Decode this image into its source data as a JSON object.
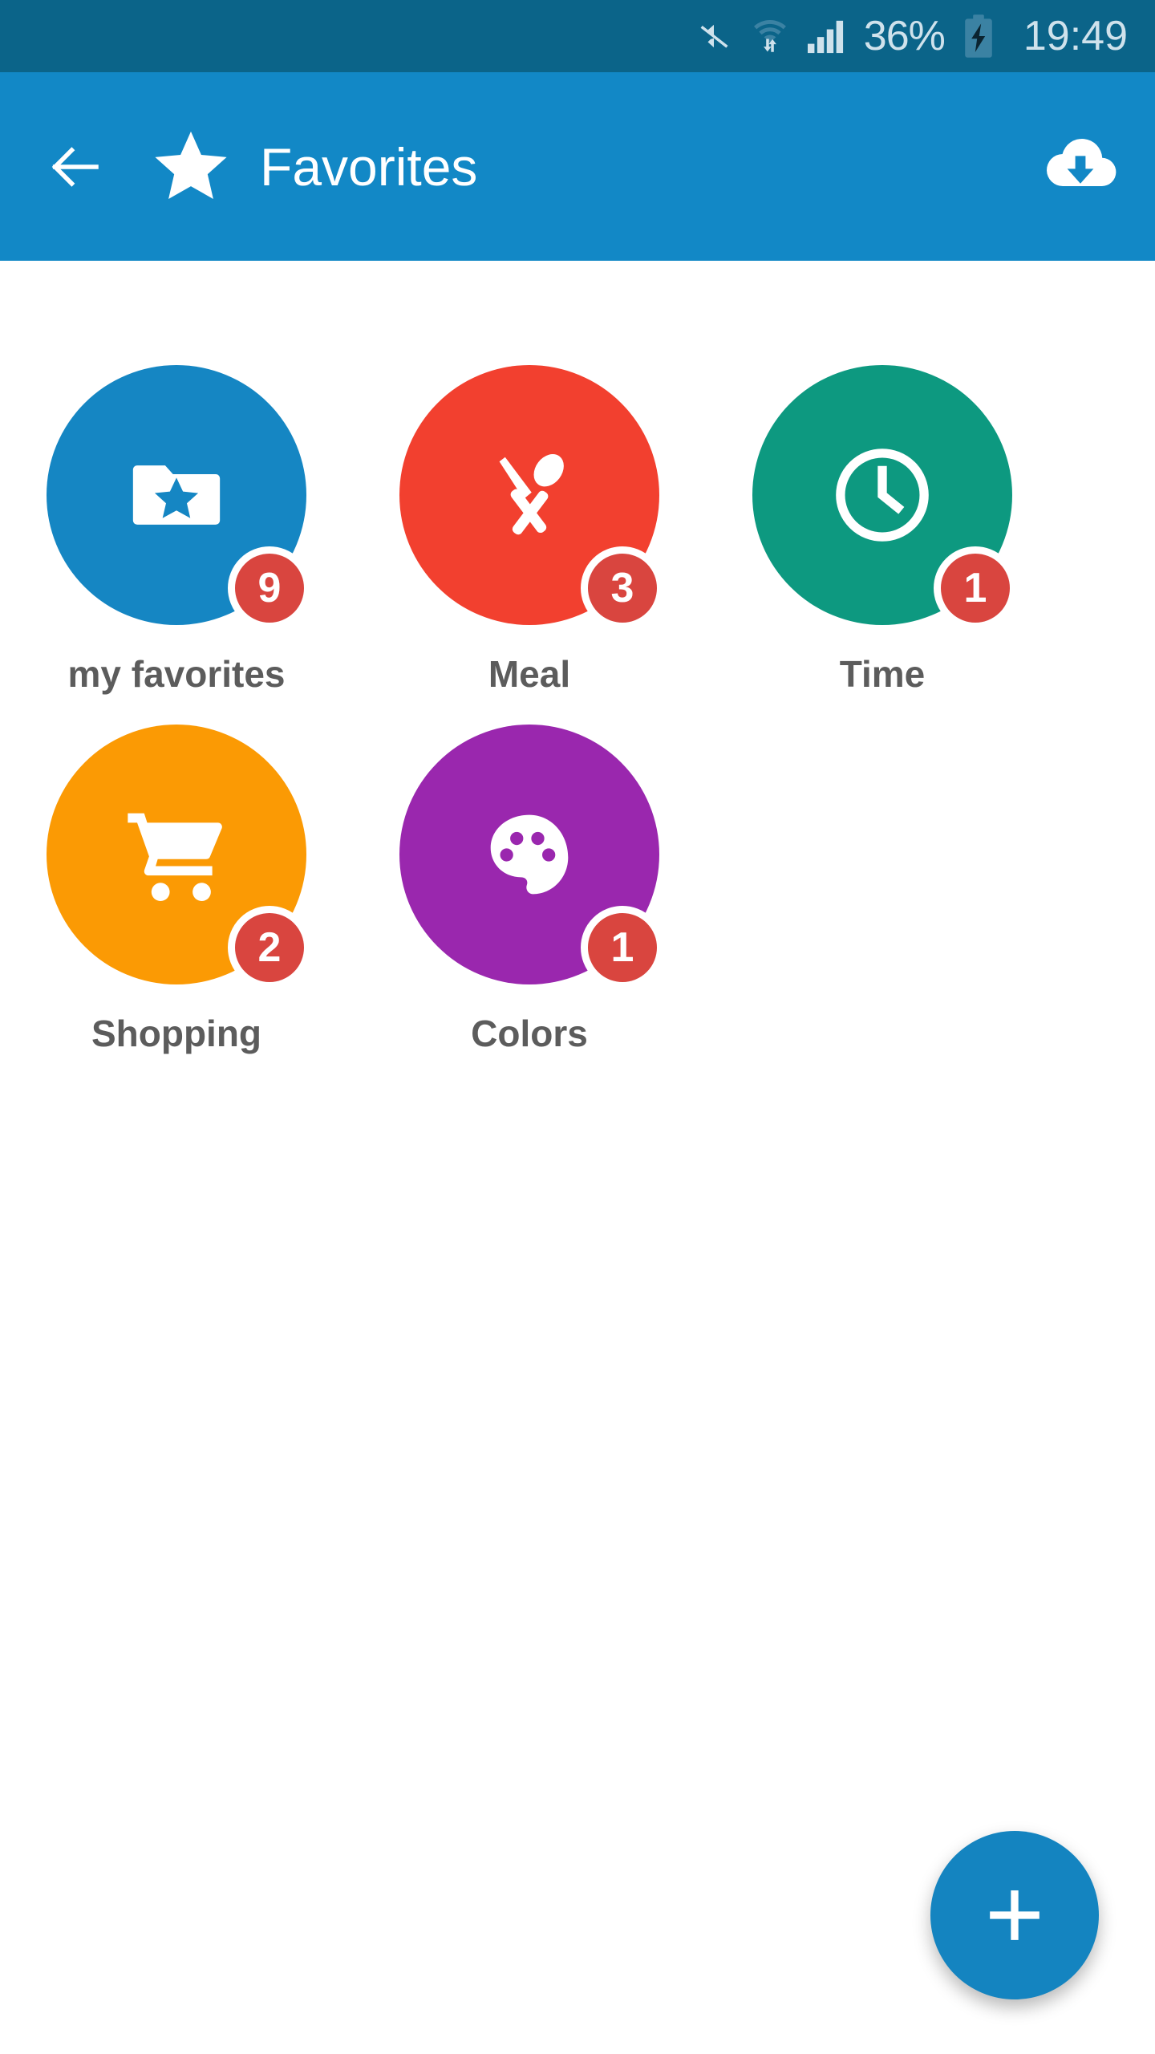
{
  "status_bar": {
    "background": "#0b6489",
    "mute_icon": "volume-mute-icon",
    "wifi_icon": "wifi-data-transfer-icon",
    "signal_icon": "cellular-signal-icon",
    "battery_percent": "36%",
    "battery_icon": "battery-charging-icon",
    "time": "19:49"
  },
  "app_bar": {
    "background": "#1288c6",
    "back_icon": "back-arrow-icon",
    "leading_icon": "star-icon",
    "title": "Favorites",
    "action_icon": "cloud-download-icon"
  },
  "grid": {
    "items": [
      {
        "label": "my favorites",
        "color": "#1586c3",
        "icon": "folder-star-icon",
        "badge": "9"
      },
      {
        "label": "Meal",
        "color": "#f2402f",
        "icon": "knife-spoon-icon",
        "badge": "3"
      },
      {
        "label": "Time",
        "color": "#0d9980",
        "icon": "clock-icon",
        "badge": "1"
      },
      {
        "label": "Shopping",
        "color": "#fb9a04",
        "icon": "shopping-cart-icon",
        "badge": "2"
      },
      {
        "label": "Colors",
        "color": "#9a27ae",
        "icon": "paint-palette-icon",
        "badge": "1"
      }
    ],
    "badge_color": "#d9453f",
    "label_color": "#5c5c5c"
  },
  "fab": {
    "icon": "plus-icon",
    "color": "#1484c0"
  }
}
